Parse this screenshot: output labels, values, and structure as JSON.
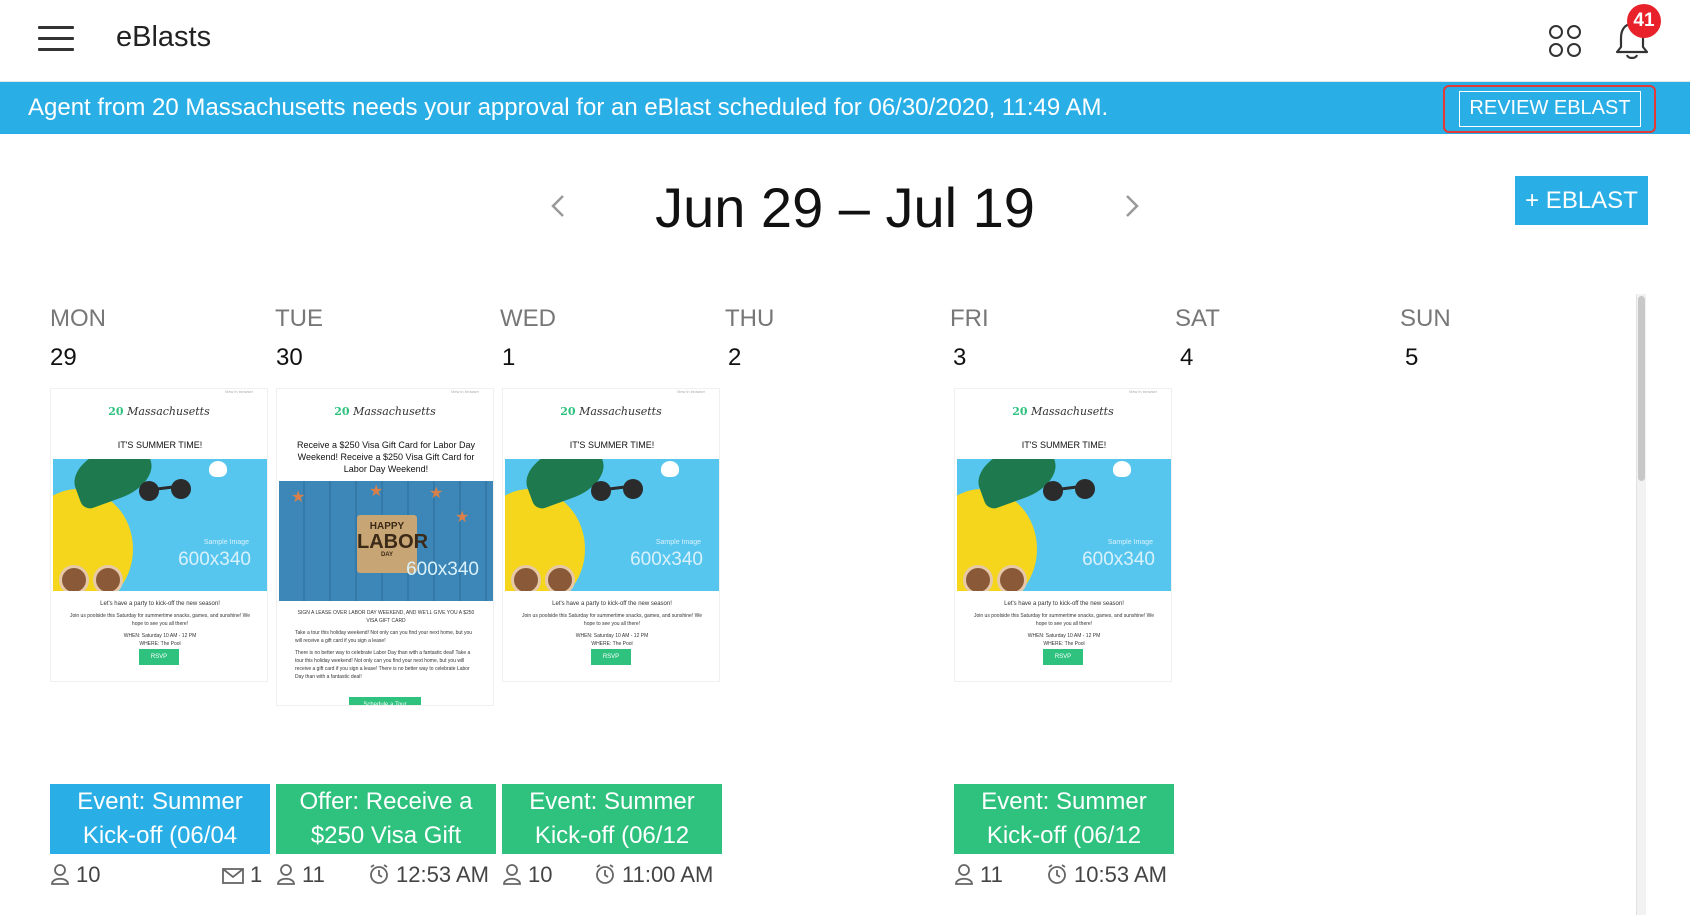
{
  "header": {
    "title": "eBlasts",
    "notification_count": "41"
  },
  "banner": {
    "message": "Agent from 20 Massachusetts needs your approval for an eBlast scheduled for 06/30/2020, 11:49 AM.",
    "review_label": "REVIEW EBLAST"
  },
  "range": {
    "label": "Jun 29 – Jul 19",
    "add_label": "+ EBLAST"
  },
  "days": [
    {
      "name": "MON",
      "num": "29"
    },
    {
      "name": "TUE",
      "num": "30"
    },
    {
      "name": "WED",
      "num": "1"
    },
    {
      "name": "THU",
      "num": "2"
    },
    {
      "name": "FRI",
      "num": "3"
    },
    {
      "name": "SAT",
      "num": "4"
    },
    {
      "name": "SUN",
      "num": "5"
    }
  ],
  "previews": {
    "summer": {
      "view_browser": "View in browser",
      "logo_num": "20",
      "logo_name": "Massachusetts",
      "headline": "IT'S SUMMER TIME!",
      "sample": "Sample Image",
      "size": "600x340",
      "line1": "Let's have a party to kick-off the new season!",
      "line2": "Join us poolside this Saturday for summertime snacks, games, and sunshine! We hope to see you all there!",
      "when": "WHEN: Saturday 10 AM - 12 PM",
      "where": "WHERE: The Pool",
      "rsvp": "RSVP"
    },
    "labor": {
      "view_browser": "View in browser",
      "logo_num": "20",
      "logo_name": "Massachusetts",
      "headline": "Receive a $250 Visa Gift Card for Labor Day Weekend! Receive a $250 Visa Gift Card for Labor Day Weekend!",
      "card_happy": "HAPPY",
      "card_labor": "LABOR",
      "card_day": "DAY",
      "size": "600x340",
      "sub": "SIGN A LEASE OVER LABOR DAY WEEKEND, AND WE'LL GIVE YOU A $250 VISA GIFT CARD",
      "body1": "Take a tour this holiday weekend! Not only can you find your next home, but you will receive a gift card if you sign a lease!",
      "body2": "There is no better way to celebrate Labor Day than with a fantastic deal! Take a tour this holiday weekend! Not only can you find your next home, but you will receive a gift card if you sign a lease! There is no better way to celebrate Labor Day than with a fantastic deal!",
      "cta": "Schedule a Tour"
    }
  },
  "events": [
    {
      "line1": "Event: Summer",
      "line2": "Kick-off (06/04",
      "recipients": "10",
      "sent": "1",
      "time": ""
    },
    {
      "line1": "Offer: Receive a",
      "line2": "$250 Visa Gift",
      "recipients": "11",
      "sent": "",
      "time": "12:53 AM"
    },
    {
      "line1": "Event: Summer",
      "line2": "Kick-off (06/12",
      "recipients": "10",
      "sent": "",
      "time": "11:00 AM"
    },
    {
      "line1": "Event: Summer",
      "line2": "Kick-off (06/12",
      "recipients": "11",
      "sent": "",
      "time": "10:53 AM"
    }
  ],
  "colors": {
    "accent_blue": "#29aee6",
    "accent_green": "#2ec27e",
    "badge_red": "#e8212b",
    "highlight_red": "#e53935"
  },
  "icons": [
    "menu-icon",
    "apps-grid-icon",
    "bell-icon",
    "chevron-left-icon",
    "chevron-right-icon",
    "person-icon",
    "mail-icon",
    "clock-icon"
  ]
}
